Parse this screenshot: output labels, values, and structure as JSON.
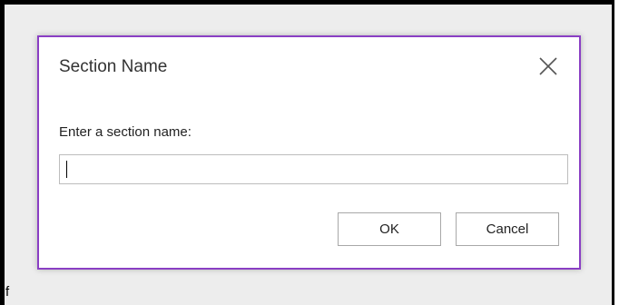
{
  "dialog": {
    "title": "Section Name",
    "close_icon": "close-icon",
    "prompt": "Enter a section name:",
    "input": {
      "value": "",
      "placeholder": ""
    },
    "buttons": {
      "ok": "OK",
      "cancel": "Cancel"
    },
    "accent_color": "#8a3fc4"
  },
  "background": {
    "partial_text": "f"
  }
}
